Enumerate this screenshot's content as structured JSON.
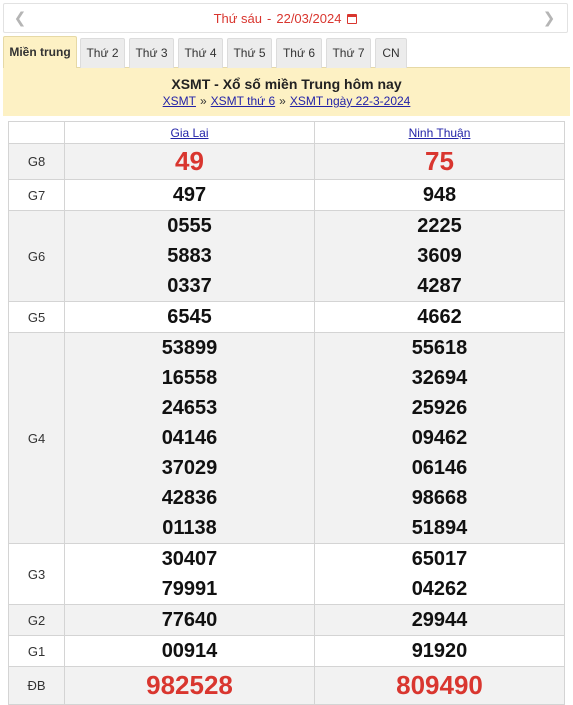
{
  "datebar": {
    "weekday": "Thứ sáu",
    "dash": "-",
    "date": "22/03/2024",
    "prev_icon": "chevron-left-icon",
    "next_icon": "chevron-right-icon",
    "calendar_icon": "calendar-icon"
  },
  "tabs": [
    "Miền trung",
    "Thứ 2",
    "Thứ 3",
    "Thứ 4",
    "Thứ 5",
    "Thứ 6",
    "Thứ 7",
    "CN"
  ],
  "header": {
    "title": "XSMT - Xổ số miền Trung hôm nay",
    "crumbs": [
      "XSMT",
      "XSMT thứ 6",
      "XSMT ngày 22-3-2024"
    ],
    "crumb_sep": "»"
  },
  "table": {
    "provinces": [
      "Gia Lai",
      "Ninh Thuận"
    ],
    "rows": [
      {
        "label": "G8",
        "a": [
          "49"
        ],
        "b": [
          "75"
        ]
      },
      {
        "label": "G7",
        "a": [
          "497"
        ],
        "b": [
          "948"
        ]
      },
      {
        "label": "G6",
        "a": [
          "0555",
          "5883",
          "0337"
        ],
        "b": [
          "2225",
          "3609",
          "4287"
        ]
      },
      {
        "label": "G5",
        "a": [
          "6545"
        ],
        "b": [
          "4662"
        ]
      },
      {
        "label": "G4",
        "a": [
          "53899",
          "16558",
          "24653",
          "04146",
          "37029",
          "42836",
          "01138"
        ],
        "b": [
          "55618",
          "32694",
          "25926",
          "09462",
          "06146",
          "98668",
          "51894"
        ]
      },
      {
        "label": "G3",
        "a": [
          "30407",
          "79991"
        ],
        "b": [
          "65017",
          "04262"
        ]
      },
      {
        "label": "G2",
        "a": [
          "77640"
        ],
        "b": [
          "29944"
        ]
      },
      {
        "label": "G1",
        "a": [
          "00914"
        ],
        "b": [
          "91920"
        ]
      },
      {
        "label": "ĐB",
        "a": [
          "982528"
        ],
        "b": [
          "809490"
        ]
      }
    ]
  },
  "colors": {
    "accent_red": "#d9362f",
    "header_bg": "#fdf1c4",
    "link_blue": "#2323a8"
  }
}
